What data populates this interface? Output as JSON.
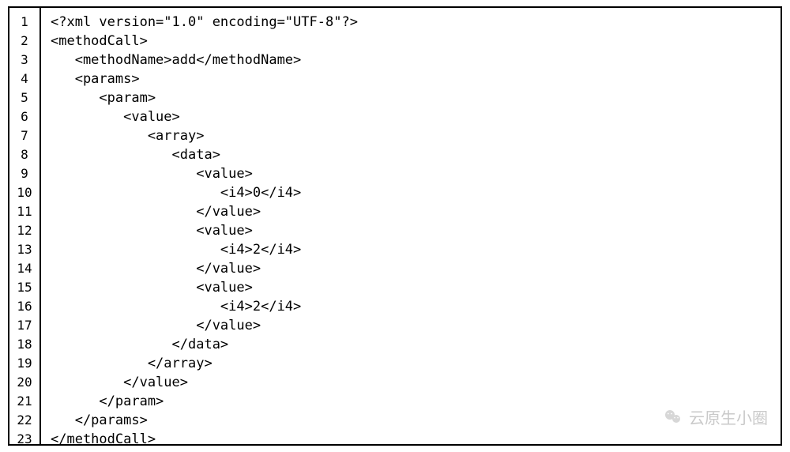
{
  "code": {
    "line_count": 23,
    "lines": [
      "<?xml version=\"1.0\" encoding=\"UTF-8\"?>",
      "<methodCall>",
      "   <methodName>add</methodName>",
      "   <params>",
      "      <param>",
      "         <value>",
      "            <array>",
      "               <data>",
      "                  <value>",
      "                     <i4>0</i4>",
      "                  </value>",
      "                  <value>",
      "                     <i4>2</i4>",
      "                  </value>",
      "                  <value>",
      "                     <i4>2</i4>",
      "                  </value>",
      "               </data>",
      "            </array>",
      "         </value>",
      "      </param>",
      "   </params>",
      "</methodCall>"
    ]
  },
  "watermark": {
    "text": "云原生小圈"
  }
}
